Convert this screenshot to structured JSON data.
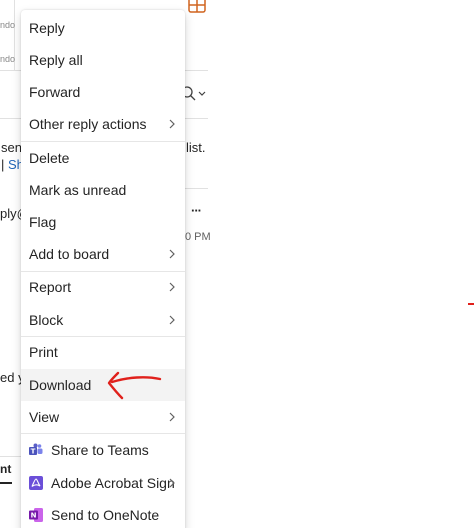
{
  "background": {
    "toolbar_fragment_1": "ndo",
    "toolbar_fragment_2": "ndo",
    "snippet_line_1": "sen",
    "snippet_list": "list.",
    "snippet_pipe": "|",
    "snippet_link": "Sh",
    "sender_fragment": "ply@",
    "more_dots": "···",
    "time_fragment": "0 PM",
    "body_fragment": "ed y",
    "bottom_fragment": "nt"
  },
  "menu": {
    "items": [
      {
        "label": "Reply",
        "submenu": false
      },
      {
        "label": "Reply all",
        "submenu": false
      },
      {
        "label": "Forward",
        "submenu": false
      },
      {
        "label": "Other reply actions",
        "submenu": true
      },
      {
        "label": "Delete",
        "submenu": false
      },
      {
        "label": "Mark as unread",
        "submenu": false
      },
      {
        "label": "Flag",
        "submenu": false
      },
      {
        "label": "Add to board",
        "submenu": true
      },
      {
        "label": "Report",
        "submenu": true
      },
      {
        "label": "Block",
        "submenu": true
      },
      {
        "label": "Print",
        "submenu": false
      },
      {
        "label": "Download",
        "submenu": false,
        "highlighted": true
      },
      {
        "label": "View",
        "submenu": true
      },
      {
        "label": "Share to Teams",
        "submenu": false,
        "icon": "teams-icon"
      },
      {
        "label": "Adobe Acrobat Sign",
        "submenu": true,
        "icon": "acrobat-icon"
      },
      {
        "label": "Send to OneNote",
        "submenu": false,
        "icon": "onenote-icon"
      }
    ]
  },
  "colors": {
    "hover": "#f3f3f3",
    "annotation_red": "#e0201b",
    "teams": "#5b5fc7",
    "acrobat": "#6b4fd8",
    "onenote": "#7719aa"
  }
}
